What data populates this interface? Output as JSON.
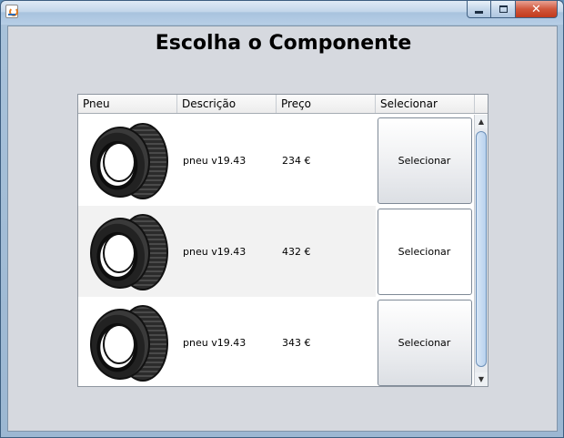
{
  "window": {
    "title": "",
    "icon": "java-cup-icon",
    "controls": {
      "minimize": "minimize-icon",
      "maximize": "maximize-icon",
      "close_label": "✕"
    }
  },
  "page": {
    "title": "Escolha o Componente"
  },
  "table": {
    "columns": [
      "Pneu",
      "Descrição",
      "Preço",
      "Selecionar"
    ],
    "rows": [
      {
        "image": "tyre-image",
        "description": "pneu v19.43",
        "price": "234 €",
        "button": "Selecionar"
      },
      {
        "image": "tyre-image",
        "description": "pneu v19.43",
        "price": "432 €",
        "button": "Selecionar"
      },
      {
        "image": "tyre-image",
        "description": "pneu v19.43",
        "price": "343 €",
        "button": "Selecionar"
      }
    ]
  },
  "scrollbar": {
    "up_arrow": "▲",
    "down_arrow": "▼"
  }
}
